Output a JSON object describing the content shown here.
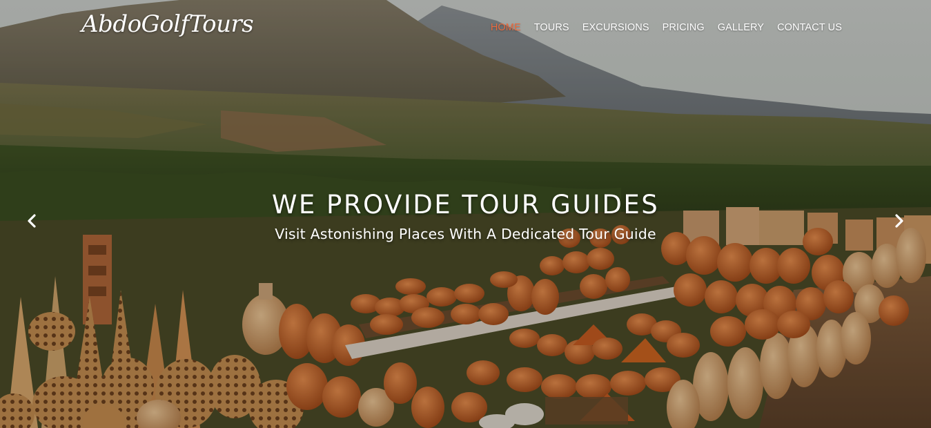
{
  "brand": {
    "logo_text": "AbdoGolfTours"
  },
  "nav": {
    "items": [
      {
        "label": "HOME",
        "active": true
      },
      {
        "label": "TOURS",
        "active": false
      },
      {
        "label": "EXCURSIONS",
        "active": false
      },
      {
        "label": "PRICING",
        "active": false
      },
      {
        "label": "GALLERY",
        "active": false
      },
      {
        "label": "CONTACT US",
        "active": false
      }
    ],
    "active_color": "#e96b3f",
    "text_color": "#ffffff"
  },
  "hero": {
    "title": "WE PROVIDE TOUR GUIDES",
    "subtitle": "Visit Astonishing Places With A Dedicated Tour Guide"
  },
  "carousel": {
    "prev_icon": "chevron-left-icon",
    "next_icon": "chevron-right-icon"
  }
}
